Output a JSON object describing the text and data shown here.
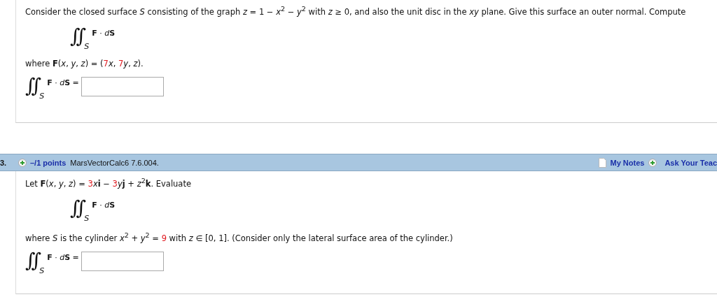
{
  "questions": [
    {
      "blocks": [
        {
          "kind": "text",
          "segments": [
            {
              "text": "Consider the closed surface *S* consisting of the graph *z* = 1 − *x*$^{2}$ − *y*$^{2}$ with *z* ≥ 0, and also the unit disc in the *xy* plane. Give this surface an outer normal. Compute",
              "kind": "plain"
            }
          ]
        },
        {
          "kind": "display",
          "sign": "∫∫",
          "domain": "S",
          "integrand": [
            "**F** · ",
            "*d*",
            "**S**"
          ]
        },
        {
          "kind": "text",
          "segments": [
            {
              "text": "where **F**(*x*, *y*, *z*) = (",
              "kind": "plain"
            },
            {
              "text": "7",
              "kind": "value"
            },
            {
              "text": "*x*, ",
              "kind": "plain"
            },
            {
              "text": "7",
              "kind": "value"
            },
            {
              "text": "*y*, *z*).",
              "kind": "plain"
            }
          ]
        },
        {
          "kind": "answer",
          "sign": "∫∫",
          "domain": "S",
          "integrand": [
            "**F** · ",
            "*d*",
            "**S**",
            " ="
          ]
        }
      ]
    },
    {
      "header": {
        "number": "3.",
        "points": "–/1 points",
        "source": "MarsVectorCalc6 7.6.004.",
        "notes": "My Notes",
        "ask": "Ask Your Teac"
      },
      "blocks": [
        {
          "kind": "text",
          "segments": [
            {
              "text": "Let **F**(*x*, *y*, *z*) = ",
              "kind": "plain"
            },
            {
              "text": "3",
              "kind": "value"
            },
            {
              "text": "*x*",
              "kind": "plain"
            },
            {
              "text": "**i** − ",
              "kind": "plain"
            },
            {
              "text": "3",
              "kind": "value"
            },
            {
              "text": "*y*",
              "kind": "plain"
            },
            {
              "text": "**j** + *z*$^{2}$",
              "kind": "plain"
            },
            {
              "text": "**k**. Evaluate",
              "kind": "plain"
            }
          ]
        },
        {
          "kind": "display",
          "sign": "∫∫",
          "domain": "S",
          "integrand": [
            "**F** · ",
            "*d*",
            "**S**"
          ]
        },
        {
          "kind": "text",
          "segments": [
            {
              "text": "where *S* is the cylinder *x*$^{2}$ + *y*$^{2}$ = ",
              "kind": "plain"
            },
            {
              "text": "9",
              "kind": "value"
            },
            {
              "text": " with *z* ∈ [0, 1]. (Consider only the lateral surface area of the cylinder.)",
              "kind": "plain"
            }
          ]
        },
        {
          "kind": "answer",
          "sign": "∫∫",
          "domain": "S",
          "integrand": [
            "**F** · ",
            "*d*",
            "**S**",
            " ="
          ]
        }
      ]
    }
  ]
}
